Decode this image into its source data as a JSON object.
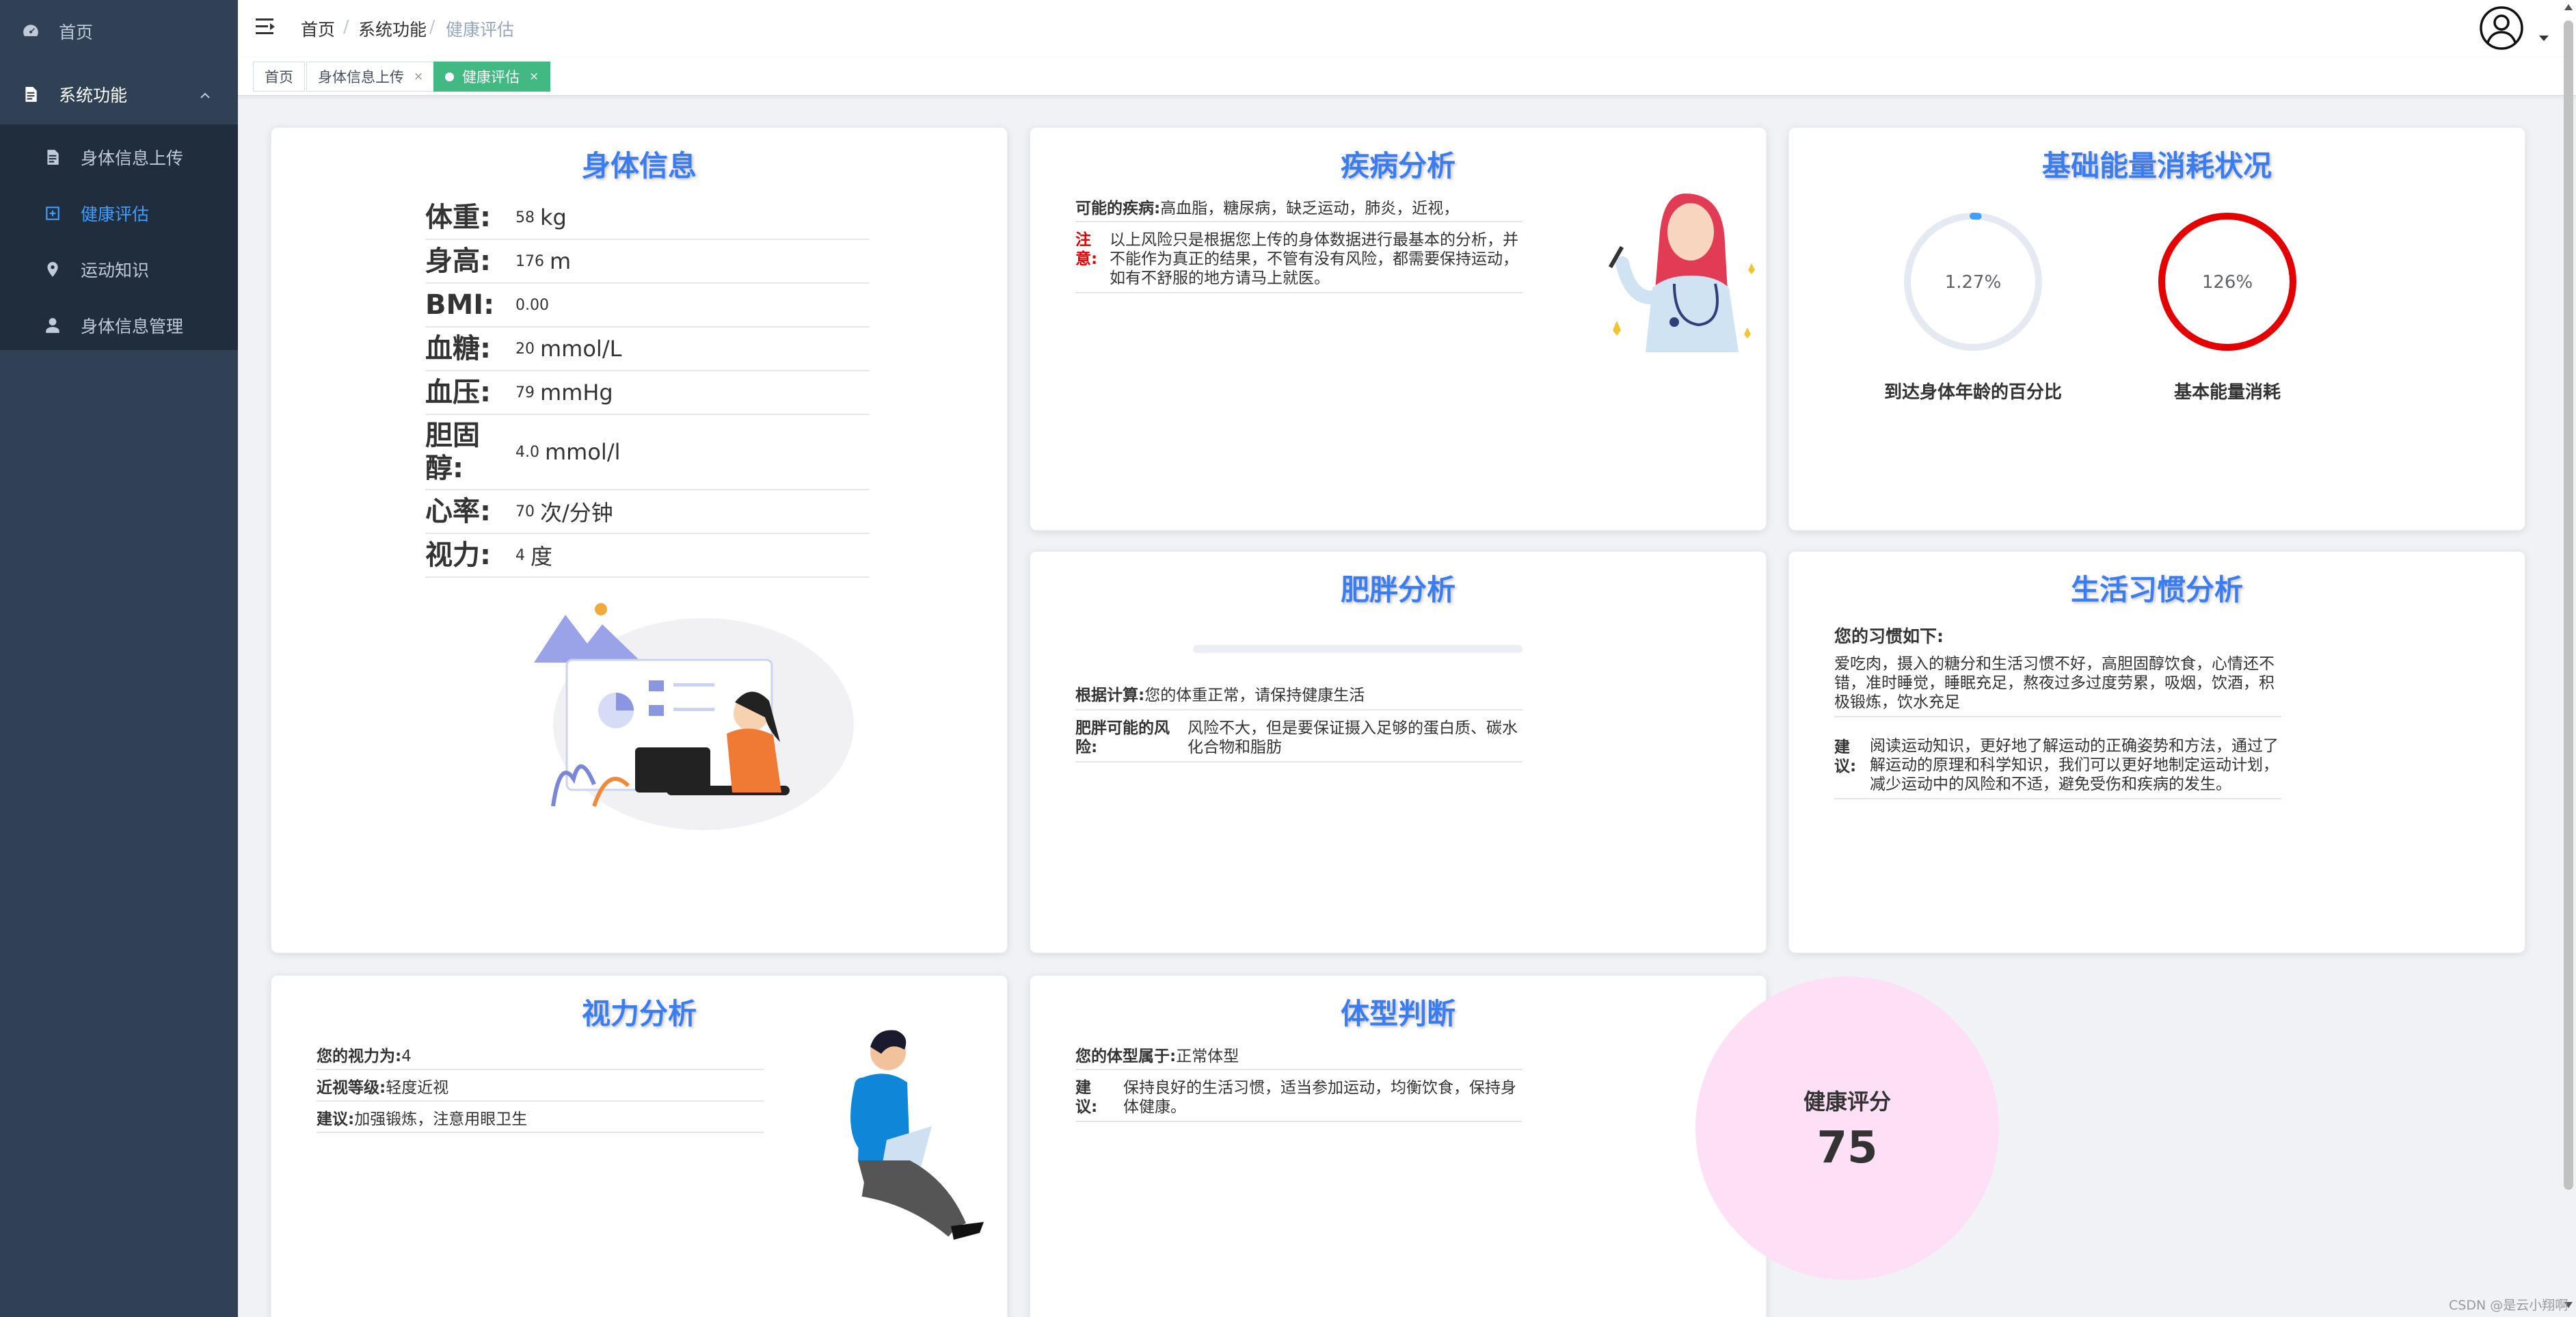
{
  "sidebar": {
    "items": [
      {
        "label": "首页"
      },
      {
        "label": "系统功能"
      },
      {
        "label": "身体信息上传"
      },
      {
        "label": "健康评估"
      },
      {
        "label": "运动知识"
      },
      {
        "label": "身体信息管理"
      }
    ]
  },
  "breadcrumb": [
    "首页",
    "系统功能",
    "健康评估"
  ],
  "tags": [
    {
      "label": "首页"
    },
    {
      "label": "身体信息上传",
      "close": "×"
    },
    {
      "label": "健康评估",
      "close": "×"
    }
  ],
  "body_info": {
    "title": "身体信息",
    "rows": [
      {
        "label": "体重:",
        "value": "58",
        "unit": "kg"
      },
      {
        "label": "身高:",
        "value": "176",
        "unit": "m"
      },
      {
        "label": "BMI:",
        "value": "0.00",
        "unit": ""
      },
      {
        "label": "血糖:",
        "value": "20",
        "unit": "mmol/L"
      },
      {
        "label": "血压:",
        "value": "79",
        "unit": "mmHg"
      },
      {
        "label": "胆固醇:",
        "value": "4.0",
        "unit": "mmol/l"
      },
      {
        "label": "心率:",
        "value": "70",
        "unit": "次/分钟"
      },
      {
        "label": "视力:",
        "value": "4",
        "unit": "度"
      }
    ]
  },
  "disease": {
    "title": "疾病分析",
    "possible_label": "可能的疾病:",
    "possible_value": "高血脂，糖尿病，缺乏运动，肺炎，近视，",
    "note_label": "注意:",
    "note_value": "以上风险只是根据您上传的身体数据进行最基本的分析，并不能作为真正的结果，不管有没有风险，都需要保持运动，如有不舒服的地方请马上就医。"
  },
  "energy": {
    "title": "基础能量消耗状况",
    "ring1": {
      "value_text": "1.27%",
      "percent": 1.27,
      "label": "到达身体年龄的百分比",
      "color": "#409eff"
    },
    "ring2": {
      "value_text": "126%",
      "percent": 126,
      "label": "基本能量消耗",
      "color": "#e40000"
    }
  },
  "obesity": {
    "title": "肥胖分析",
    "progress_percent": 0,
    "calc_label": "根据计算:",
    "calc_value": "您的体重正常，请保持健康生活",
    "risk_label": "肥胖可能的风险:",
    "risk_value": "风险不大，但是要保证摄入足够的蛋白质、碳水化合物和脂肪"
  },
  "habits": {
    "title": "生活习惯分析",
    "intro": "您的习惯如下:",
    "habits_text": "爱吃肉，摄入的糖分和生活习惯不好，高胆固醇饮食，心情还不错，准时睡觉，睡眠充足，熬夜过多过度劳累，吸烟，饮酒，积极锻炼，饮水充足",
    "advice_label": "建议:",
    "advice_text": "阅读运动知识，更好地了解运动的正确姿势和方法，通过了解运动的原理和科学知识，我们可以更好地制定运动计划，减少运动中的风险和不适，避免受伤和疾病的发生。"
  },
  "vision": {
    "title": "视力分析",
    "rows": [
      {
        "label": "您的视力为:",
        "value": "4"
      },
      {
        "label": "近视等级:",
        "value": "轻度近视"
      },
      {
        "label": "建议:",
        "value": "加强锻炼，注意用眼卫生"
      }
    ]
  },
  "body_type": {
    "title": "体型判断",
    "type_label": "您的体型属于:",
    "type_value": "正常体型",
    "advice_label": "建议:",
    "advice_value": "保持良好的生活习惯，适当参加运动，均衡饮食，保持身体健康。"
  },
  "score": {
    "label": "健康评分",
    "value": "75"
  },
  "watermark": "CSDN @是云小翔啊"
}
